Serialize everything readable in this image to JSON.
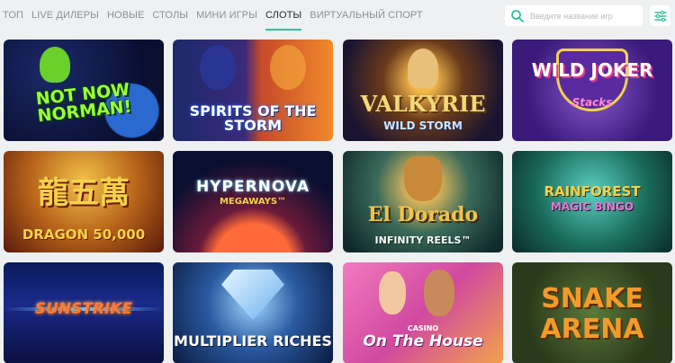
{
  "nav": {
    "tabs": [
      {
        "label": "ТОП",
        "active": false
      },
      {
        "label": "LIVE ДИЛЕРЫ",
        "active": false
      },
      {
        "label": "НОВЫЕ",
        "active": false
      },
      {
        "label": "СТОЛЫ",
        "active": false
      },
      {
        "label": "МИНИ ИГРЫ",
        "active": false
      },
      {
        "label": "СЛОТЫ",
        "active": true
      },
      {
        "label": "ВИРТУАЛЬНЫЙ СПОРТ",
        "active": false
      }
    ],
    "accent_color": "#2ec29a"
  },
  "search": {
    "placeholder": "Введите название игр",
    "icon": "search-icon"
  },
  "filter": {
    "icon": "sliders-icon"
  },
  "games": [
    {
      "title": "NOT NOW NORMAN!"
    },
    {
      "title": "SPIRITS OF THE STORM"
    },
    {
      "title": "VALKYRIE",
      "subtitle": "WILD STORM"
    },
    {
      "title": "WILD JOKER",
      "subtitle": "Stacks"
    },
    {
      "title": "龍五萬",
      "subtitle": "DRAGON 50,000"
    },
    {
      "title": "HYPERNOVA",
      "subtitle": "MEGAWAYS™"
    },
    {
      "title": "El Dorado",
      "subtitle": "INFINITY REELS™"
    },
    {
      "title": "RAINFOREST",
      "subtitle": "MAGIC BINGO"
    },
    {
      "title": "SUNSTRIKE"
    },
    {
      "title": "MULTIPLIER RICHES"
    },
    {
      "title": "On The House",
      "subtitle": "CASINO"
    },
    {
      "title": "SNAKE",
      "subtitle": "ARENA"
    }
  ]
}
